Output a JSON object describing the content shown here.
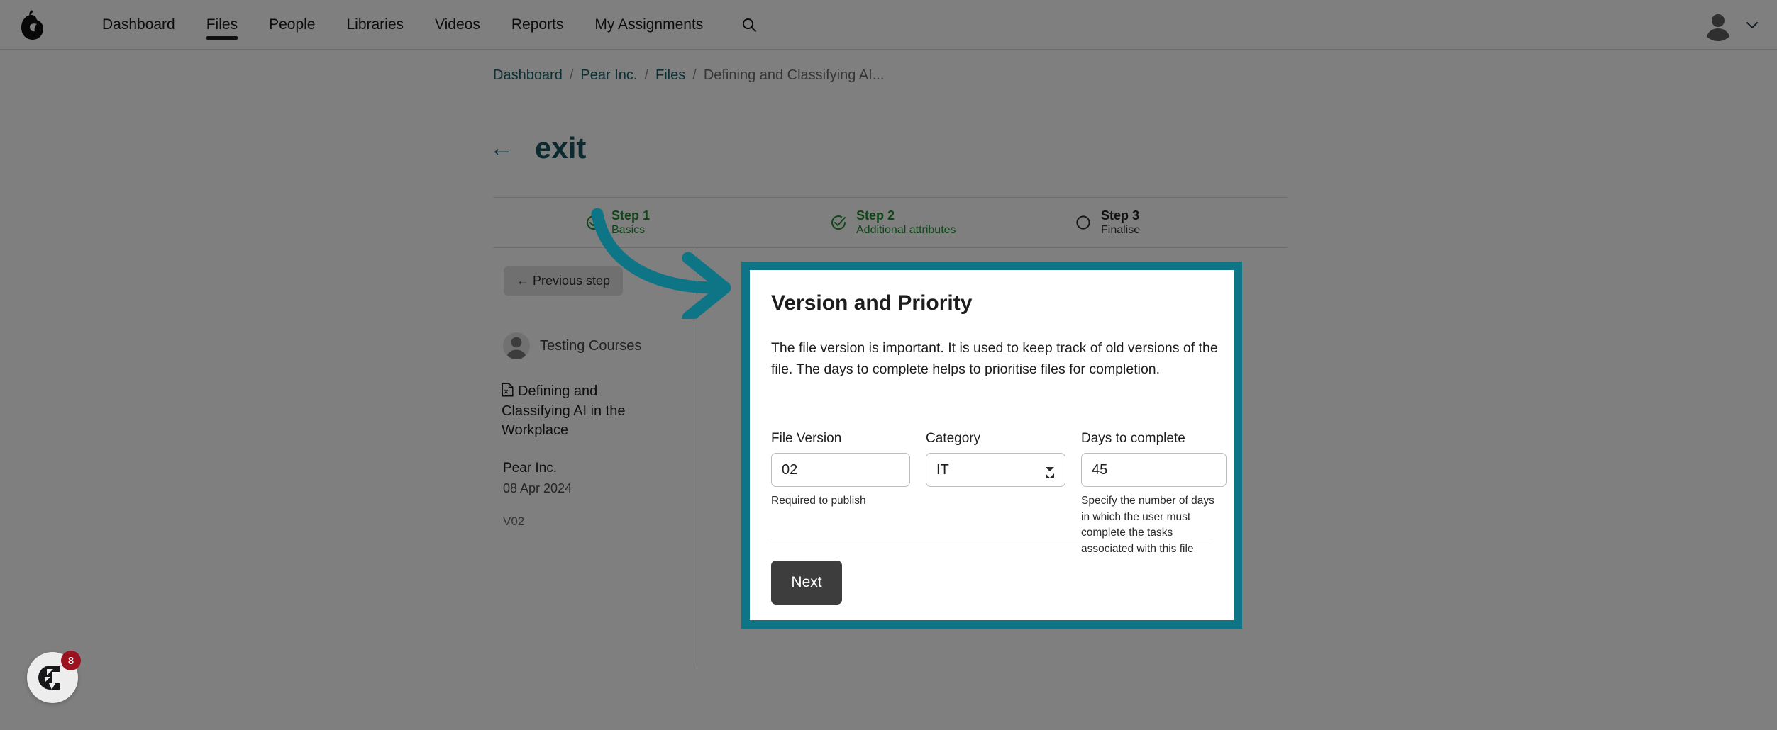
{
  "nav": {
    "logo_icon": "pear-logo-icon",
    "items": [
      {
        "label": "Dashboard",
        "active": false
      },
      {
        "label": "Files",
        "active": true
      },
      {
        "label": "People",
        "active": false
      },
      {
        "label": "Libraries",
        "active": false
      },
      {
        "label": "Videos",
        "active": false
      },
      {
        "label": "Reports",
        "active": false
      },
      {
        "label": "My Assignments",
        "active": false
      }
    ],
    "search_icon": "search-icon",
    "avatar_icon": "user-avatar-icon",
    "caret_icon": "chevron-down-icon"
  },
  "breadcrumb": {
    "items": [
      {
        "label": "Dashboard",
        "current": false
      },
      {
        "label": "Pear Inc.",
        "current": false
      },
      {
        "label": "Files",
        "current": false
      },
      {
        "label": "Defining and Classifying AI...",
        "current": true
      }
    ],
    "separator": "/"
  },
  "header": {
    "back_icon": "arrow-left-icon",
    "title": "exit"
  },
  "stepper": {
    "steps": [
      {
        "name": "Step 1",
        "sub": "Basics",
        "state": "done"
      },
      {
        "name": "Step 2",
        "sub": "Additional attributes",
        "state": "done"
      },
      {
        "name": "Step 3",
        "sub": "Finalise",
        "state": "todo"
      }
    ]
  },
  "sidebar": {
    "previous_step_label": "← Previous step",
    "user_name": "Testing Courses",
    "file_name": "Defining and Classifying AI in the Workplace",
    "file_icon": "document-icon",
    "org": "Pear Inc.",
    "date": "08 Apr 2024",
    "version": "V02"
  },
  "card": {
    "title": "Version and Priority",
    "description": "The file version is important. It is used to keep track of old versions of the file. The days to complete helps to prioritise files for completion.",
    "border_color": "#0d7585",
    "fields": {
      "file_version": {
        "label": "File Version",
        "value": "02",
        "help": "Required to publish"
      },
      "category": {
        "label": "Category",
        "value": "IT",
        "options": [
          "IT"
        ]
      },
      "days_to_complete": {
        "label": "Days to complete",
        "value": "45",
        "help": "Specify the number of days in which the user must complete the tasks associated with this file"
      }
    },
    "next_label": "Next"
  },
  "annotation": {
    "arrow_icon": "curved-arrow-right-icon",
    "arrow_color": "#0d7585"
  },
  "help_widget": {
    "icon": "help-logo-icon",
    "badge_count": "8",
    "badge_color": "#9b1320"
  }
}
